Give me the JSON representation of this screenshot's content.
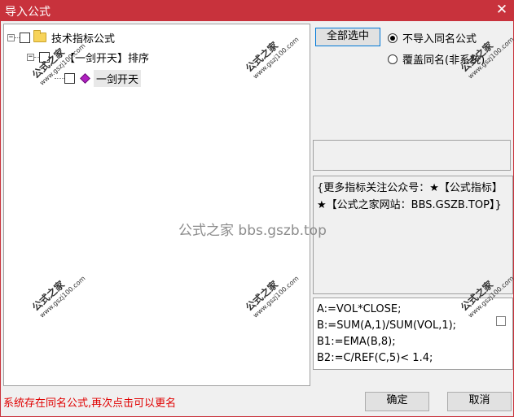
{
  "window": {
    "title": "导入公式",
    "close_glyph": "✕"
  },
  "tree": {
    "root": {
      "label": "技术指标公式",
      "expander": "−"
    },
    "child": {
      "label": "【一剑开天】排序",
      "expander": "−"
    },
    "leaf": {
      "label": "一剑开天"
    }
  },
  "buttons": {
    "select_all": "全部选中",
    "ok": "确定",
    "cancel": "取消"
  },
  "options": {
    "no_import_same": "不导入同名公式",
    "overwrite_same": "覆盖同名(非系统)"
  },
  "description": "{更多指标关注公众号：★【公式指标】★【公式之家网站：BBS.GSZB.TOP】}",
  "code_lines": [
    "A:=VOL*CLOSE;",
    "B:=SUM(A,1)/SUM(VOL,1);",
    "B1:=EMA(B,8);",
    "B2:=C/REF(C,5)< 1.4;"
  ],
  "status_message": "系统存在同名公式,再次点击可以更名",
  "watermarks": {
    "main": "公式之家",
    "url": "www.gszj100.com",
    "center": "公式之家 bbs.gszb.top"
  }
}
